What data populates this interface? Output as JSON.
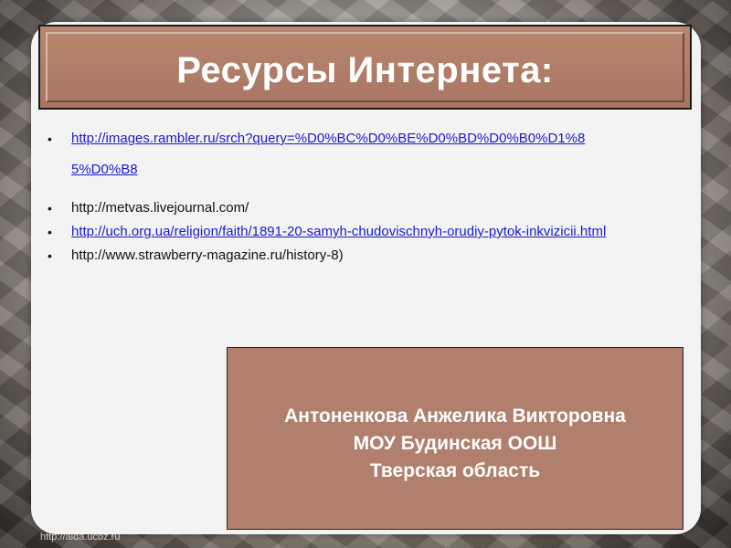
{
  "title": "Ресурсы Интернета:",
  "links": [
    {
      "line1": "http://images.rambler.ru/srch?query=%D0%BC%D0%BE%D0%BD%D0%B0%D1%8",
      "line2": "5%D0%B8",
      "hyperlink": true
    },
    {
      "text": "http://metvas.livejournal.com/",
      "hyperlink": false
    },
    {
      "text": "http://uch.org.ua/religion/faith/1891-20-samyh-chudovischnyh-orudiy-pytok-inkvizicii.html",
      "hyperlink": true
    },
    {
      "text": "http://www.strawberry-magazine.ru/history-8)",
      "hyperlink": false
    }
  ],
  "author": {
    "name": "Антоненкова Анжелика Викторовна",
    "school": "МОУ Будинская ООШ",
    "region": "Тверская область"
  },
  "footer_url": "http://aida.ucoz.ru",
  "colors": {
    "title_box": "#b07f6d",
    "panel": "#f3f3f3",
    "link": "#1a1ad0"
  }
}
